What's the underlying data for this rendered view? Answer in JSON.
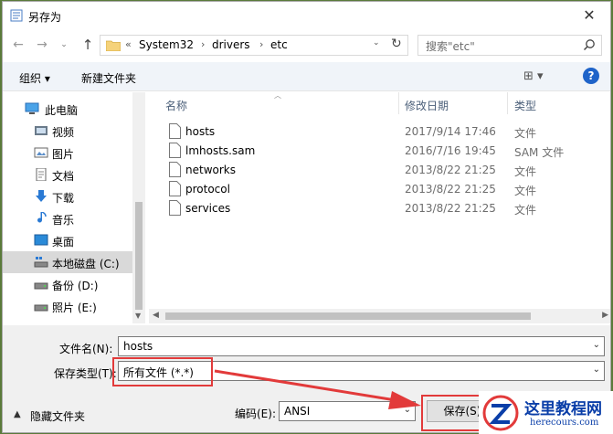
{
  "window": {
    "title": "另存为",
    "close_glyph": "✕"
  },
  "nav": {
    "back": "←",
    "forward": "→",
    "recent": "⌄",
    "up": "↑",
    "breadcrumb": {
      "overflow": "«",
      "items": [
        "System32",
        "drivers",
        "etc"
      ],
      "separator": "›"
    },
    "address_dropdown": "⌄",
    "refresh": "↻",
    "search_placeholder": "搜索\"etc\""
  },
  "toolbar": {
    "organize": "组织 ▾",
    "new_folder": "新建文件夹",
    "view": "⊞ ▾",
    "help": "?"
  },
  "sidebar": {
    "items": [
      {
        "label": "此电脑",
        "icon": "computer-icon"
      },
      {
        "label": "视频",
        "icon": "video-icon"
      },
      {
        "label": "图片",
        "icon": "pictures-icon"
      },
      {
        "label": "文档",
        "icon": "documents-icon"
      },
      {
        "label": "下载",
        "icon": "download-icon"
      },
      {
        "label": "音乐",
        "icon": "music-icon"
      },
      {
        "label": "桌面",
        "icon": "desktop-icon"
      },
      {
        "label": "本地磁盘 (C:)",
        "icon": "drive-icon",
        "selected": true
      },
      {
        "label": "备份 (D:)",
        "icon": "drive-icon"
      },
      {
        "label": "照片 (E:)",
        "icon": "drive-icon"
      }
    ]
  },
  "files": {
    "columns": {
      "name": "名称",
      "date": "修改日期",
      "type": "类型"
    },
    "rows": [
      {
        "name": "hosts",
        "date": "2017/9/14 17:46",
        "type": "文件"
      },
      {
        "name": "lmhosts.sam",
        "date": "2016/7/16 19:45",
        "type": "SAM 文件"
      },
      {
        "name": "networks",
        "date": "2013/8/22 21:25",
        "type": "文件"
      },
      {
        "name": "protocol",
        "date": "2013/8/22 21:25",
        "type": "文件"
      },
      {
        "name": "services",
        "date": "2013/8/22 21:25",
        "type": "文件"
      }
    ]
  },
  "form": {
    "filename_label": "文件名(N):",
    "filename_value": "hosts",
    "filetype_label": "保存类型(T):",
    "filetype_value": "所有文件  (*.*)",
    "encoding_label": "编码(E):",
    "encoding_value": "ANSI",
    "save_button": "保存(S)",
    "hide_folders": "隐藏文件夹",
    "hide_glyph": "▲"
  },
  "watermark": {
    "title": "这里教程网",
    "url": "herecours.com"
  },
  "colors": {
    "annotation": "#e23a3a",
    "help_blue": "#1e63c9",
    "selection": "#d9d9d9"
  }
}
